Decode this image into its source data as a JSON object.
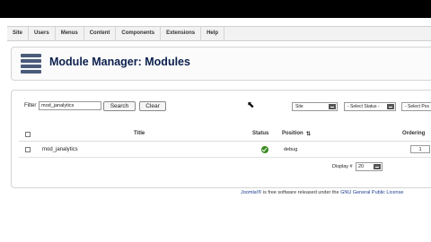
{
  "menu": [
    "Site",
    "Users",
    "Menus",
    "Content",
    "Components",
    "Extensions",
    "Help"
  ],
  "header": {
    "title": "Module Manager: Modules"
  },
  "filter": {
    "label": "Filter",
    "value": "mod_janalytics",
    "go_label": "Search",
    "reset_label": "Clear",
    "client_select": "Site",
    "status_select": "- Select Status -",
    "position_select": "- Select Pos"
  },
  "table": {
    "headers": {
      "title": "Title",
      "status": "Status",
      "position": "Position",
      "ordering": "Ordering"
    },
    "rows": [
      {
        "title": "mod_janalytics",
        "status": "published",
        "position": "debug",
        "ordering": "1"
      }
    ]
  },
  "pagination": {
    "display_label": "Display #",
    "limit": "20"
  },
  "footer": {
    "brand": "Joomla!®",
    "text": " is free software released under the ",
    "license": "GNU General Public License"
  },
  "colors": {
    "title": "#0b1f4d",
    "status_published": "#3a8a1e"
  }
}
